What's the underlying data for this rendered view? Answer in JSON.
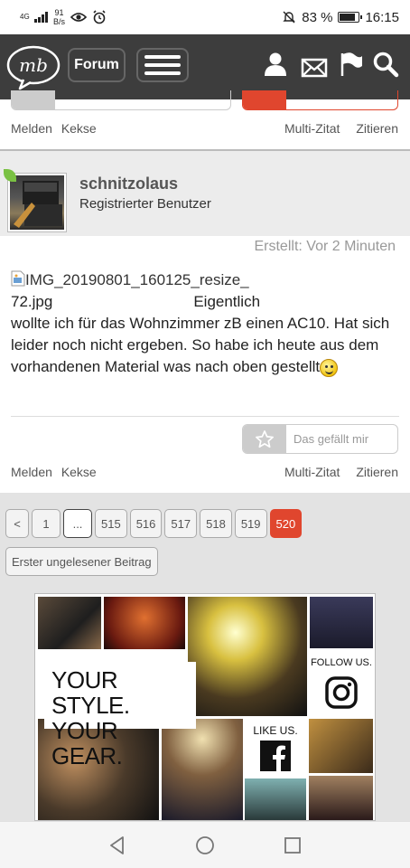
{
  "status_bar": {
    "network": "4G",
    "speed_value": "91",
    "speed_unit": "B/s",
    "battery": "83 %",
    "battery_level": 0.83,
    "time": "16:15"
  },
  "header": {
    "logo_text": "mb",
    "forum_button": "Forum",
    "icons": [
      "user-icon",
      "mail-icon",
      "flag-icon",
      "search-icon"
    ]
  },
  "previous_post": {
    "actions_left": [
      "Melden",
      "Kekse"
    ],
    "actions_right": [
      "Multi-Zitat",
      "Zitieren"
    ]
  },
  "post": {
    "username": "schnitzolaus",
    "user_title": "Registrierter Benutzer",
    "created": "Erstellt: Vor 2 Minuten",
    "image_alt_line1": "IMG_20190801_160125_resize_",
    "image_alt_line2": "72.jpg",
    "body_line1": "Eigentlich",
    "body_rest": "wollte ich für das Wohnzimmer zB einen AC10. Hat sich leider noch nicht ergeben. So habe ich heute aus dem vorhandenen Material was nach oben gestellt",
    "like_label": "Das gefällt mir",
    "actions_left": [
      "Melden",
      "Kekse"
    ],
    "actions_right": [
      "Multi-Zitat",
      "Zitieren"
    ]
  },
  "pagination": {
    "prev": "<",
    "pages": [
      "1",
      "...",
      "515",
      "516",
      "517",
      "518",
      "519",
      "520"
    ],
    "current": "520",
    "first_unread": "Erster ungelesener Beitrag"
  },
  "ad": {
    "headline_1": "YOUR STYLE.",
    "headline_2": "YOUR GEAR.",
    "follow": "FOLLOW US.",
    "like_us": "LIKE US."
  }
}
